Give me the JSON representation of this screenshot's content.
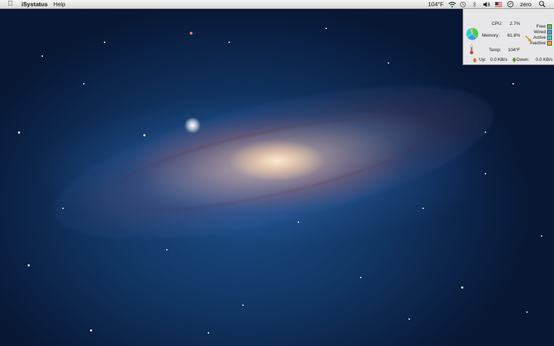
{
  "menubar": {
    "apple_icon": "apple-icon",
    "app_name": "iSystatus",
    "help_label": "Help",
    "temperature": "104°F",
    "user": "zero",
    "status_icons": [
      "wifi-icon",
      "time-machine-icon",
      "bluetooth-icon",
      "volume-icon",
      "flag-icon",
      "clock-icon",
      "spotlight-icon"
    ]
  },
  "panel": {
    "cpu_label": "CPU:",
    "cpu_value": "2.7%",
    "memory_label": "Memory:",
    "memory_value": "61.8%",
    "temp_label": "Temp:",
    "temp_value": "104°F",
    "legend": [
      {
        "label": "Free",
        "color": "#4fc94f"
      },
      {
        "label": "Wired",
        "color": "#3a9ee0"
      },
      {
        "label": "Active",
        "color": "#2fd0c8"
      },
      {
        "label": "Inactive",
        "color": "#f0a020"
      }
    ],
    "memory_pie": [
      {
        "name": "Free",
        "fraction": 0.38,
        "color": "#4fc94f"
      },
      {
        "name": "Wired",
        "fraction": 0.27,
        "color": "#3a9ee0"
      },
      {
        "name": "Active",
        "fraction": 0.3,
        "color": "#2fd0c8"
      },
      {
        "name": "Inactive",
        "fraction": 0.05,
        "color": "#f0a020"
      }
    ],
    "up_label": "Up:",
    "up_value": "0.0 KB/s",
    "down_label": "Down:",
    "down_value": "0.0 KB/s"
  }
}
